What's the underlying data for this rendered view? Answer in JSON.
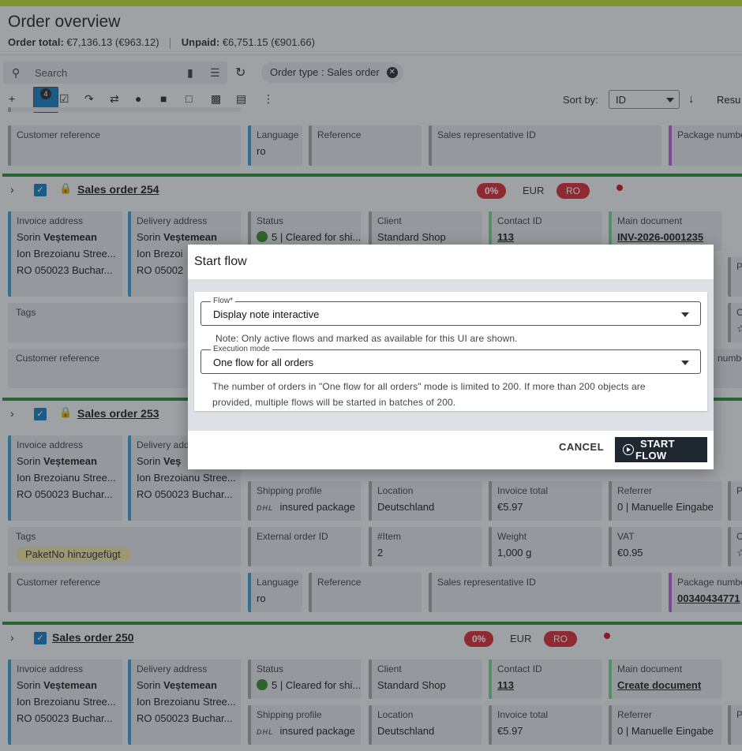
{
  "page": {
    "title": "Order overview",
    "order_total_label": "Order total:",
    "order_total_value": "€7,136.13",
    "order_total_tax": "(€963.12)",
    "unpaid_label": "Unpaid:",
    "unpaid_value": "€6,751.15",
    "unpaid_tax": "(€901.66)"
  },
  "search": {
    "placeholder": "Search"
  },
  "filter_chip": "Order type : Sales order",
  "toolbar": {
    "selected_count": "4",
    "sort_label": "Sort by:",
    "sort_value": "ID",
    "results_label": "Resu"
  },
  "row_top": {
    "customer_reference": "Customer reference",
    "language_label": "Language",
    "language_value": "ro",
    "reference": "Reference",
    "sales_rep": "Sales representative ID",
    "package_number": "Package numbe"
  },
  "orders": [
    {
      "title": "Sales order 254",
      "discount": "0%",
      "currency": "EUR",
      "country": "RO",
      "invoice_label": "Invoice address",
      "invoice_name_first": "Sorin",
      "invoice_name_last": "Veștemean",
      "invoice_street": "Ion Brezoianu Stree...",
      "invoice_city": "RO 050023 Buchar...",
      "delivery_label": "Delivery address",
      "delivery_name_first": "Sorin",
      "delivery_name_last": "Veștemean",
      "delivery_street": "Ion Brezoi",
      "delivery_city": "RO 05002",
      "status_label": "Status",
      "status_value": "5 | Cleared for shi...",
      "client_label": "Client",
      "client_value": "Standard Shop",
      "contact_label": "Contact ID",
      "contact_value": "113",
      "doc_label": "Main document",
      "doc_value": "INV-2026-0001235",
      "pa": "Pa",
      "tags_label": "Tags",
      "co": "Co",
      "customer_reference": "Customer reference",
      "numbe": "numbe"
    },
    {
      "title": "Sales order 253",
      "invoice_label": "Invoice address",
      "invoice_name_first": "Sorin",
      "invoice_name_last": "Veștemean",
      "invoice_street": "Ion Brezoianu Stree...",
      "invoice_city": "RO 050023 Buchar...",
      "delivery_label": "Delivery add",
      "delivery_name_first": "Sorin",
      "delivery_name_last": "Veș",
      "delivery_street": "Ion Brezoianu Stree...",
      "delivery_city": "RO 050023 Buchar...",
      "shipping_label": "Shipping profile",
      "shipping_carrier": "DHL",
      "shipping_value": "insured package",
      "location_label": "Location",
      "location_value": "Deutschland",
      "invoice_total_label": "Invoice total",
      "invoice_total_value": "€5.97",
      "referrer_label": "Referrer",
      "referrer_value": "0 | Manuelle Eingabe",
      "pa": "Pa",
      "tags_label": "Tags",
      "tag": "PaketNo hinzugefügt",
      "external_label": "External order ID",
      "item_label": "#Item",
      "item_value": "2",
      "weight_label": "Weight",
      "weight_value": "1,000 g",
      "vat_label": "VAT",
      "vat_value": "€0.95",
      "co": "Co",
      "customer_reference": "Customer reference",
      "language_label": "Language",
      "language_value": "ro",
      "reference": "Reference",
      "sales_rep": "Sales representative ID",
      "package_label": "Package numbe",
      "package_value": "00340434771"
    },
    {
      "title": "Sales order 250",
      "discount": "0%",
      "currency": "EUR",
      "country": "RO",
      "invoice_label": "Invoice address",
      "invoice_name_first": "Sorin",
      "invoice_name_last": "Veștemean",
      "invoice_street": "Ion Brezoianu Stree...",
      "invoice_city": "RO 050023 Buchar...",
      "delivery_label": "Delivery address",
      "delivery_name_first": "Sorin",
      "delivery_name_last": "Veștemean",
      "delivery_street": "Ion Brezoianu Stree...",
      "delivery_city": "RO 050023 Buchar...",
      "status_label": "Status",
      "status_value": "5 | Cleared for shi...",
      "client_label": "Client",
      "client_value": "Standard Shop",
      "contact_label": "Contact ID",
      "contact_value": "113",
      "doc_label": "Main document",
      "doc_value": "Create document",
      "shipping_label": "Shipping profile",
      "shipping_carrier": "DHL",
      "shipping_value": "insured package",
      "location_label": "Location",
      "location_value": "Deutschland",
      "invoice_total_label": "Invoice total",
      "invoice_total_value": "€5.97",
      "referrer_label": "Referrer",
      "referrer_value": "0 | Manuelle Eingabe",
      "pa": "Pa"
    }
  ],
  "modal": {
    "title": "Start flow",
    "flow_label": "Flow*",
    "flow_value": "Display note interactive",
    "flow_note": "Note: Only active flows and marked as available for this UI are shown.",
    "mode_label": "Execution mode",
    "mode_value": "One flow for all orders",
    "mode_note": "The number of orders in \"One flow for all orders\" mode is limited to 200. If more than 200 objects are provided, multiple flows will be started in batches of 200.",
    "cancel_label": "CANCEL",
    "start_label": "START FLOW"
  },
  "colors": {
    "accent": "#1a7fc3",
    "order_stripe": "#2e8b3c",
    "danger": "#d62f3c",
    "primary_button": "#1f2730"
  }
}
